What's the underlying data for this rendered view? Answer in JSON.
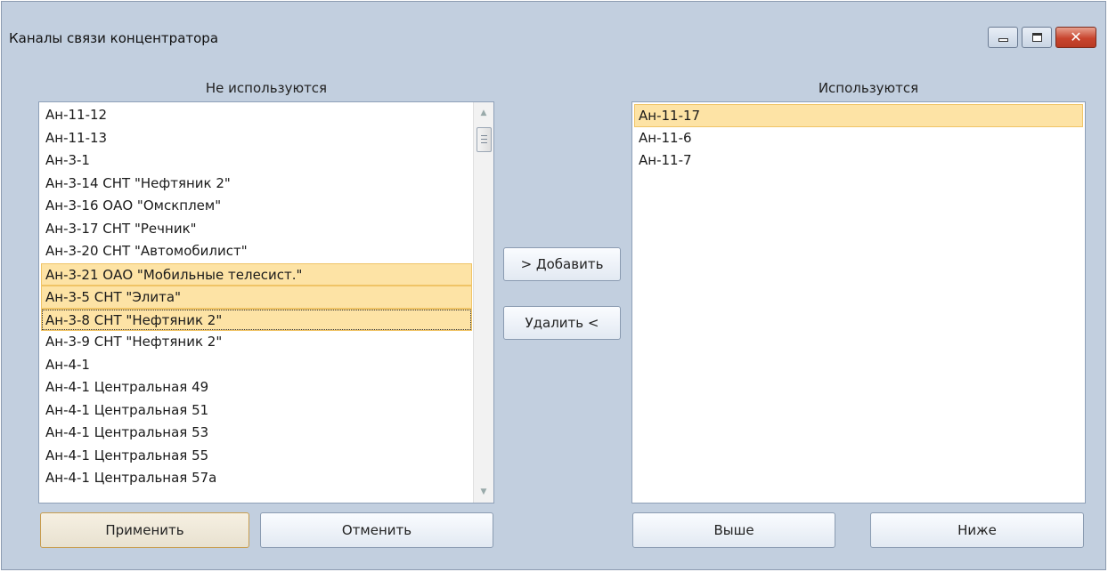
{
  "window": {
    "title": "Каналы связи концентратора",
    "controls": {
      "minimize_icon": "minimize-icon",
      "maximize_icon": "maximize-icon",
      "close_icon": "close-icon"
    }
  },
  "left": {
    "label": "Не используются",
    "items": [
      "Ан-11-12",
      "Ан-11-13",
      "Ан-3-1",
      "Ан-3-14 СНТ \"Нефтяник 2\"",
      "Ан-3-16 ОАО \"Омскплем\"",
      "Ан-3-17 СНТ \"Речник\"",
      "Ан-3-20 СНТ \"Автомобилист\"",
      "Ан-3-21 ОАО \"Мобильные телесист.\"",
      "Ан-3-5 СНТ \"Элита\"",
      "Ан-3-8 СНТ \"Нефтяник 2\"",
      "Ан-3-9 СНТ \"Нефтяник 2\"",
      "Ан-4-1",
      "Ан-4-1 Центральная 49",
      "Ан-4-1 Центральная 51",
      "Ан-4-1 Центральная 53",
      "Ан-4-1 Центральная 55",
      "Ан-4-1 Центральная 57а"
    ],
    "selected": [
      7,
      8,
      9
    ],
    "focused": 9
  },
  "right": {
    "label": "Используются",
    "items": [
      "Ан-11-17",
      "Ан-11-6",
      "Ан-11-7"
    ],
    "selected": [
      0
    ]
  },
  "buttons": {
    "add": "> Добавить",
    "remove": "Удалить <",
    "apply": "Применить",
    "cancel": "Отменить",
    "up": "Выше",
    "down": "Ниже"
  },
  "colors": {
    "window_bg": "#c2cfdf",
    "selection_bg": "#fde3a5",
    "selection_border": "#f0c466"
  }
}
